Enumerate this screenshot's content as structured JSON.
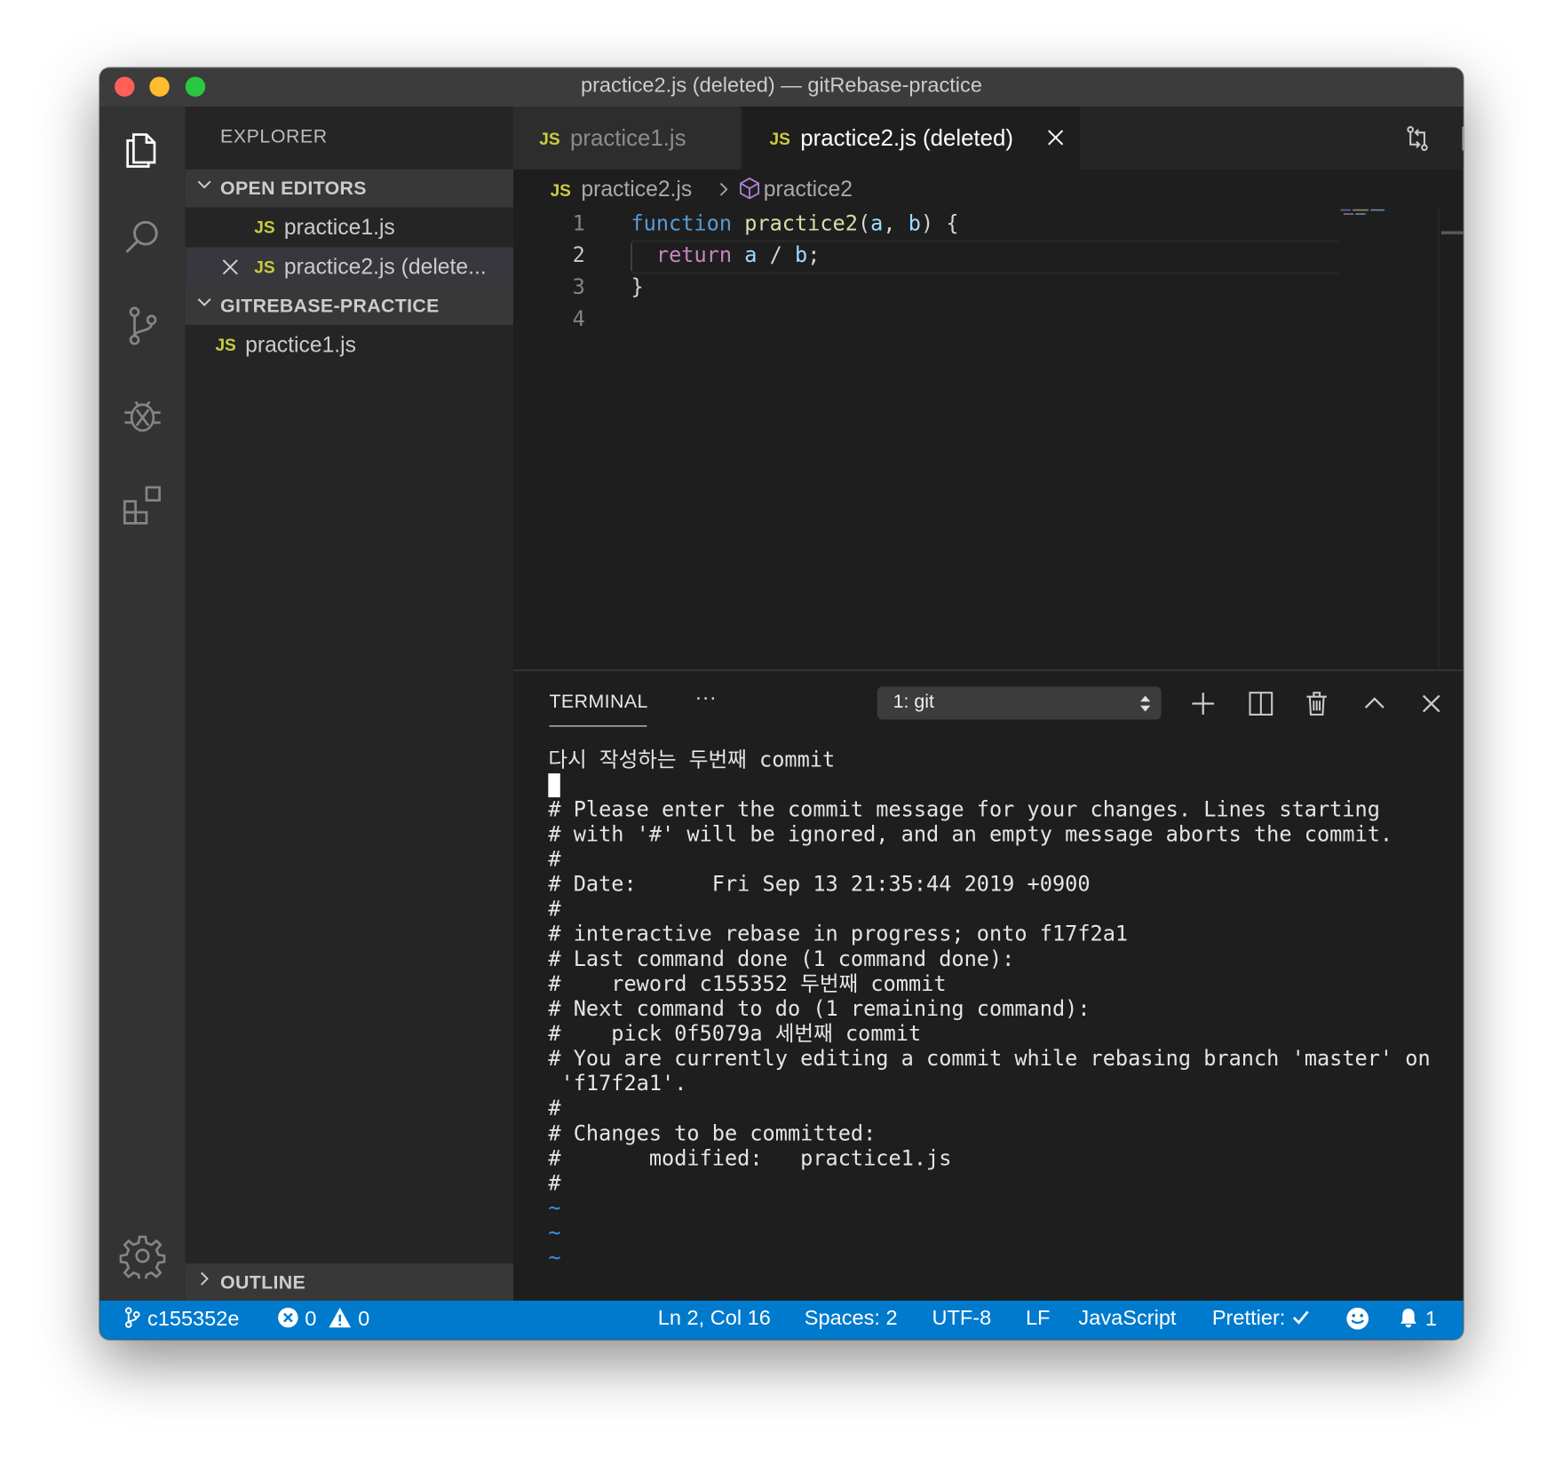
{
  "window": {
    "title": "practice2.js (deleted) — gitRebase-practice"
  },
  "sidebar": {
    "title": "EXPLORER",
    "open_editors": {
      "label": "OPEN EDITORS",
      "items": [
        {
          "icon": "JS",
          "name": "practice1.js"
        },
        {
          "icon": "JS",
          "name": "practice2.js (delete..."
        }
      ]
    },
    "workspace": {
      "label": "GITREBASE-PRACTICE",
      "items": [
        {
          "icon": "JS",
          "name": "practice1.js"
        }
      ]
    },
    "outline": {
      "label": "OUTLINE"
    }
  },
  "tabs": [
    {
      "icon": "JS",
      "label": "practice1.js",
      "active": false
    },
    {
      "icon": "JS",
      "label": "practice2.js (deleted)",
      "active": true
    }
  ],
  "breadcrumb": {
    "icon": "JS",
    "file": "practice2.js",
    "symbol": "practice2"
  },
  "editor": {
    "line_numbers": [
      "1",
      "2",
      "3",
      "4"
    ],
    "lines": [
      {
        "t1": "function",
        "t2": "practice2",
        "t3": "(",
        "t4": "a",
        "t5": ", ",
        "t6": "b",
        "t7": ") {"
      },
      {
        "t1": "return",
        "t2": "a",
        "t3": " / ",
        "t4": "b",
        "t5": ";"
      },
      {
        "t1": "}"
      }
    ]
  },
  "panel": {
    "title": "TERMINAL",
    "more": "···",
    "terminal_select": "1: git",
    "terminal_lines": [
      "다시 작성하는 두번째 commit",
      "",
      "# Please enter the commit message for your changes. Lines starting",
      "# with '#' will be ignored, and an empty message aborts the commit.",
      "#",
      "# Date:      Fri Sep 13 21:35:44 2019 +0900",
      "#",
      "# interactive rebase in progress; onto f17f2a1",
      "# Last command done (1 command done):",
      "#    reword c155352 두번째 commit",
      "# Next command to do (1 remaining command):",
      "#    pick 0f5079a 세번째 commit",
      "# You are currently editing a commit while rebasing branch 'master' on",
      " 'f17f2a1'.",
      "#",
      "# Changes to be committed:",
      "#       modified:   practice1.js",
      "#",
      "~",
      "~",
      "~"
    ]
  },
  "status": {
    "branch": "c155352e",
    "errors": "0",
    "warnings": "0",
    "position": "Ln 2, Col 16",
    "spaces": "Spaces: 2",
    "encoding": "UTF-8",
    "eol": "LF",
    "language": "JavaScript",
    "formatter": "Prettier:",
    "notifications": "1"
  },
  "colors": {
    "status_bar": "#007acc",
    "js_icon": "#cbcb41",
    "keyword": "#569cd6",
    "function_name": "#dcdcaa",
    "parameter": "#9cdcfe",
    "control_keyword": "#c586c0",
    "terminal_tilde": "#3b8eea"
  }
}
